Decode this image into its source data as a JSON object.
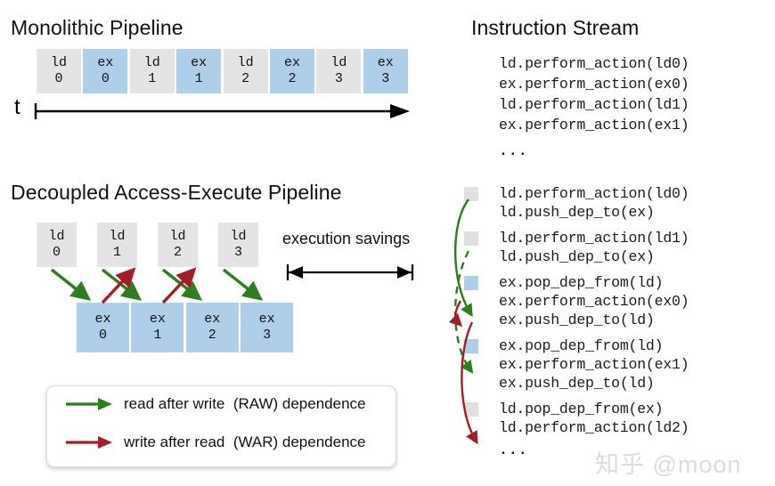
{
  "colors": {
    "ld_box": "#e4e4e4",
    "ex_box": "#aecfe9",
    "raw_green": "#2e7d1e",
    "war_red": "#a81b28",
    "text": "#111111",
    "watermark": "#dcdcdc"
  },
  "monolithic": {
    "title": "Monolithic Pipeline",
    "stages": [
      {
        "kind": "ld",
        "top": "ld",
        "bottom": "0"
      },
      {
        "kind": "ex",
        "top": "ex",
        "bottom": "0"
      },
      {
        "kind": "ld",
        "top": "ld",
        "bottom": "1"
      },
      {
        "kind": "ex",
        "top": "ex",
        "bottom": "1"
      },
      {
        "kind": "ld",
        "top": "ld",
        "bottom": "2"
      },
      {
        "kind": "ex",
        "top": "ex",
        "bottom": "2"
      },
      {
        "kind": "ld",
        "top": "ld",
        "bottom": "3"
      },
      {
        "kind": "ex",
        "top": "ex",
        "bottom": "3"
      }
    ],
    "time_axis_label": "t"
  },
  "decoupled": {
    "title": "Decoupled Access-Execute Pipeline",
    "ld_stages": [
      {
        "top": "ld",
        "bottom": "0"
      },
      {
        "top": "ld",
        "bottom": "1"
      },
      {
        "top": "ld",
        "bottom": "2"
      },
      {
        "top": "ld",
        "bottom": "3"
      }
    ],
    "ex_stages": [
      {
        "top": "ex",
        "bottom": "0"
      },
      {
        "top": "ex",
        "bottom": "1"
      },
      {
        "top": "ex",
        "bottom": "2"
      },
      {
        "top": "ex",
        "bottom": "3"
      }
    ],
    "savings_label": "execution savings"
  },
  "legend": {
    "entries": [
      {
        "arrow": "raw-arrow",
        "color": "#2e7d1e",
        "text": "read after write  (RAW) dependence"
      },
      {
        "arrow": "war-arrow",
        "color": "#a81b28",
        "text": "write after read  (WAR) dependence"
      }
    ]
  },
  "instruction_stream": {
    "title": "Instruction Stream",
    "top_block": {
      "lines": [
        "ld.perform_action(ld0)",
        "ex.perform_action(ex0)",
        "ld.perform_action(ld1)",
        "ex.perform_action(ex1)"
      ],
      "ellipsis": "..."
    },
    "bottom_block": {
      "groups": [
        {
          "marker": "ld",
          "lines": [
            "ld.perform_action(ld0)",
            "ld.push_dep_to(ex)"
          ]
        },
        {
          "marker": "ld",
          "lines": [
            "ld.perform_action(ld1)",
            "ld.push_dep_to(ex)"
          ]
        },
        {
          "marker": "ex",
          "lines": [
            "ex.pop_dep_from(ld)",
            "ex.perform_action(ex0)",
            "ex.push_dep_to(ld)"
          ]
        },
        {
          "marker": "ex",
          "lines": [
            "ex.pop_dep_from(ld)",
            "ex.perform_action(ex1)",
            "ex.push_dep_to(ld)"
          ]
        },
        {
          "marker": "ld",
          "lines": [
            "ld.pop_dep_from(ex)",
            "ld.perform_action(ld2)"
          ]
        }
      ],
      "ellipsis": "..."
    }
  },
  "watermark": {
    "text": "知乎 @moon"
  }
}
